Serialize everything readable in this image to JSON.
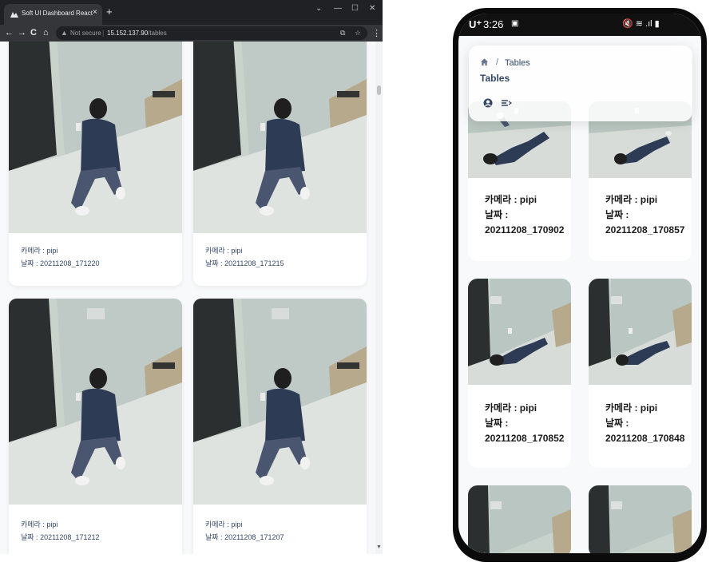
{
  "browser": {
    "tab_title": "Soft UI Dashboard React",
    "tab_close": "×",
    "new_tab": "+",
    "controls": {
      "down": "⌄",
      "minimize": "—",
      "maximize": "☐",
      "close": "✕"
    },
    "nav": {
      "back": "←",
      "forward": "→",
      "reload": "C",
      "home": "⌂"
    },
    "security_label": "Not secure",
    "url_host": "15.152.137.90",
    "url_path": "/tables",
    "menu": "⋮"
  },
  "desktop_cards": [
    {
      "camera_label": "카메라 : ",
      "camera": "pipi",
      "date_label": "날짜 : ",
      "date": "20211208_171220"
    },
    {
      "camera_label": "카메라 : ",
      "camera": "pipi",
      "date_label": "날짜 : ",
      "date": "20211208_171215"
    },
    {
      "camera_label": "카메라 : ",
      "camera": "pipi",
      "date_label": "날짜 : ",
      "date": "20211208_171212"
    },
    {
      "camera_label": "카메라 : ",
      "camera": "pipi",
      "date_label": "날짜 : ",
      "date": "20211208_171207"
    }
  ],
  "phone": {
    "status": {
      "carrier": "U⁺",
      "time": "3:26",
      "right": "🔇 ≋ .ıl ▮"
    },
    "breadcrumb": {
      "page": "Tables",
      "separator": "/"
    },
    "title": "Tables",
    "cards": [
      {
        "camera_line": "카메라 : pipi",
        "date_label": "날짜 :",
        "date": "20211208_170902"
      },
      {
        "camera_line": "카메라 : pipi",
        "date_label": "날짜 :",
        "date": "20211208_170857"
      },
      {
        "camera_line": "카메라 : pipi",
        "date_label": "날짜 :",
        "date": "20211208_170852"
      },
      {
        "camera_line": "카메라 : pipi",
        "date_label": "날짜 :",
        "date": "20211208_170848"
      }
    ]
  }
}
